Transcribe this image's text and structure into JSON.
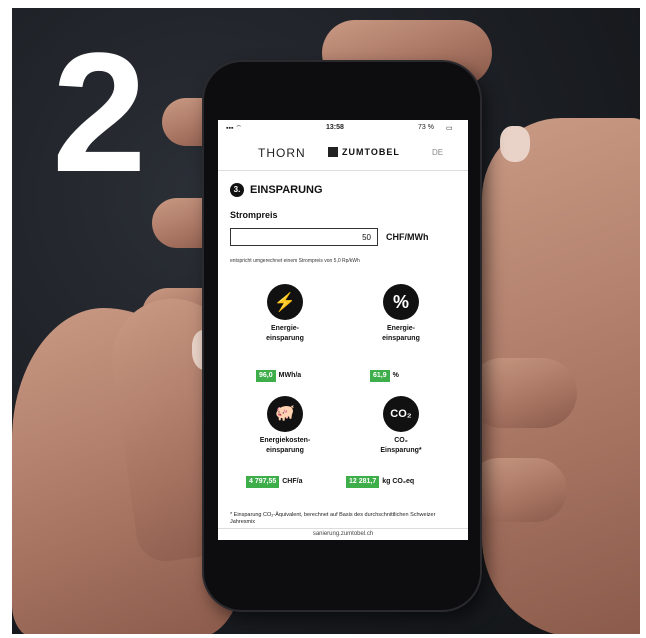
{
  "big_number": "2",
  "status": {
    "time": "13:58",
    "battery": "73 %"
  },
  "brands": {
    "left": "THORN",
    "right": "ZUMTOBEL",
    "lang": "DE"
  },
  "section": {
    "number": "3.",
    "title": "EINSPARUNG"
  },
  "price": {
    "label": "Strompreis",
    "value": "50",
    "unit": "CHF/MWh",
    "note": "entspricht umgerechnet einem Strompreis von 5,0 Rp/kWh"
  },
  "tiles": [
    {
      "icon": "lightning-icon",
      "glyph": "⚡",
      "label": "Energie-\neinsparung",
      "value": "96,0",
      "unit": "MWh/a"
    },
    {
      "icon": "percent-icon",
      "glyph": "%",
      "label": "Energie-\neinsparung",
      "value": "61,9",
      "unit": "%"
    },
    {
      "icon": "piggy-bank-icon",
      "glyph": "🐖",
      "label": "Energiekosten-\neinsparung",
      "value": "4 797,55",
      "unit": "CHF/a"
    },
    {
      "icon": "co2-cloud-icon",
      "glyph": "CO₂",
      "label": "CO₂\nEinsparung*",
      "value": "12 281,7",
      "unit": "kg CO₂eq"
    }
  ],
  "footnote": "* Einsparung CO₂-Äquivalent, berechnet auf Basis des durchschnittlichen Schweizer Jahresmix",
  "url": "sanierung.zumtobel.ch",
  "colors": {
    "accent": "#3eae4a",
    "background": "#1b1e23"
  }
}
